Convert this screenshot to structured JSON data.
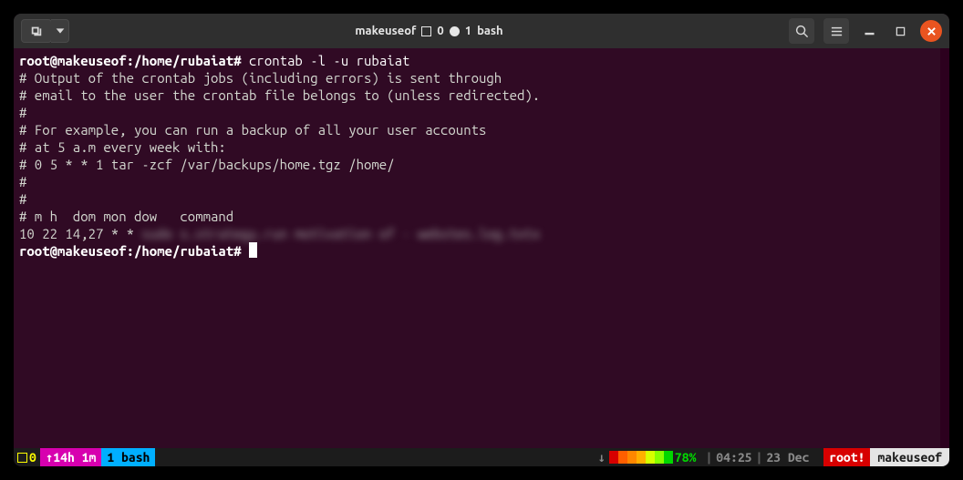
{
  "titlebar": {
    "title_prefix": "makeuseof",
    "title_num1": "0",
    "title_num2": "1",
    "title_shell": "bash"
  },
  "terminal": {
    "prompt": "root@makeuseof:/home/rubaiat#",
    "command": "crontab -l -u rubaiat",
    "lines": [
      "# Output of the crontab jobs (including errors) is sent through",
      "# email to the user the crontab file belongs to (unless redirected).",
      "#",
      "# For example, you can run a backup of all your user accounts",
      "# at 5 a.m every week with:",
      "# 0 5 * * 1 tar -zcf /var/backups/home.tgz /home/",
      "#",
      "#",
      "# m h  dom mon dow   command",
      "",
      "10 22 14,27 * *"
    ],
    "blurred_text": "sudo s.strategy.run motivation of - webstes.log.txtx"
  },
  "statusbar": {
    "sessions": "0",
    "uptime": "14h 1m",
    "window": "1 bash",
    "battery_pct": "78%",
    "time": "04:25",
    "date": "23 Dec",
    "user": "root!",
    "host": "makeuseof",
    "heat_colors": [
      "#d70000",
      "#ff5f00",
      "#ff8700",
      "#ffaf00",
      "#ffff00",
      "#87ff00",
      "#00d700"
    ]
  }
}
